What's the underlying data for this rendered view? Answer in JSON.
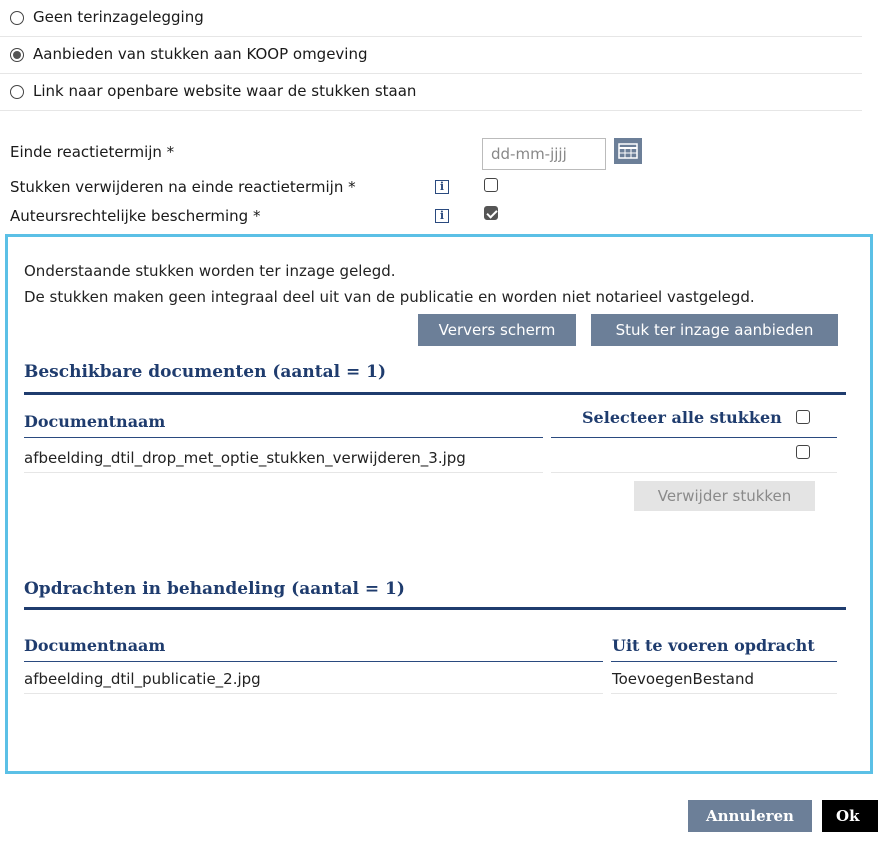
{
  "radio_options": {
    "geen": "Geen terinzagelegging",
    "koop": "Aanbieden van stukken aan KOOP omgeving",
    "link": "Link naar openbare website waar de stukken staan"
  },
  "form": {
    "einde_label": "Einde reactietermijn *",
    "date_placeholder": "dd-mm-jjjj",
    "verwijderen_label": "Stukken verwijderen na einde reactietermijn *",
    "auteurs_label": "Auteursrechtelijke bescherming *",
    "info_glyph": "i"
  },
  "panel": {
    "intro_line1": "Onderstaande stukken worden ter inzage gelegd.",
    "intro_line2": "De stukken maken geen integraal deel uit van de publicatie en worden niet notarieel vastgelegd.",
    "refresh_button": "Ververs scherm",
    "offer_button": "Stuk ter inzage aanbieden"
  },
  "beschikbaar": {
    "title": "Beschikbare documenten (aantal = 1)",
    "col_name": "Documentnaam",
    "col_select": "Selecteer alle stukken",
    "rows": [
      {
        "name": "afbeelding_dtil_drop_met_optie_stukken_verwijderen_3.jpg",
        "selected": false
      }
    ],
    "delete_button": "Verwijder stukken"
  },
  "opdrachten": {
    "title": "Opdrachten in behandeling (aantal = 1)",
    "col_name": "Documentnaam",
    "col_action": "Uit te voeren opdracht",
    "rows": [
      {
        "name": "afbeelding_dtil_publicatie_2.jpg",
        "action": "ToevoegenBestand"
      }
    ]
  },
  "footer": {
    "cancel_button": "Annuleren",
    "ok_button": "Ok",
    "ok_chevron": "❯"
  },
  "state": {
    "selected_radio": "koop",
    "verwijderen_checked": false,
    "auteurs_checked": true
  },
  "colors": {
    "accent_border": "#5bc0e6",
    "heading_navy": "#1f3c6e",
    "button_steel": "#6c7f98",
    "ok_black": "#000000"
  }
}
